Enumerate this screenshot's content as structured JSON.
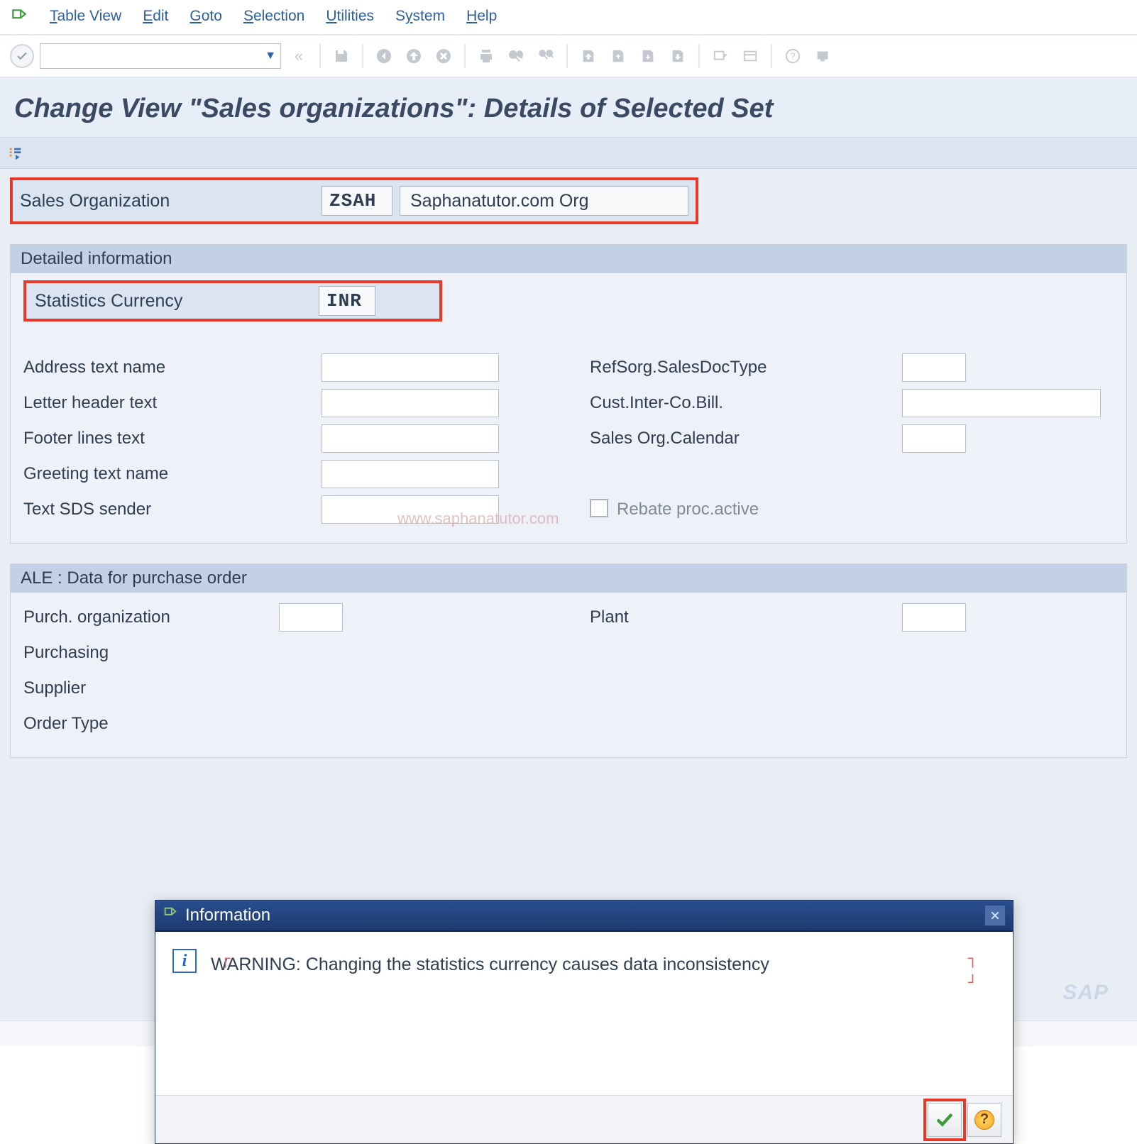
{
  "menu": {
    "items": [
      {
        "label_pre": "",
        "ul": "T",
        "label_post": "able View"
      },
      {
        "label_pre": "",
        "ul": "E",
        "label_post": "dit"
      },
      {
        "label_pre": "",
        "ul": "G",
        "label_post": "oto"
      },
      {
        "label_pre": "",
        "ul": "S",
        "label_post": "election"
      },
      {
        "label_pre": "",
        "ul": "U",
        "label_post": "tilities"
      },
      {
        "label_pre": "S",
        "ul": "y",
        "label_post": "stem"
      },
      {
        "label_pre": "",
        "ul": "H",
        "label_post": "elp"
      }
    ]
  },
  "title": "Change View \"Sales organizations\": Details of Selected Set",
  "header": {
    "label": "Sales Organization",
    "code": "ZSAH",
    "desc": "Saphanatutor.com Org"
  },
  "group1": {
    "title": "Detailed information",
    "stat_label": "Statistics Currency",
    "stat_value": "INR",
    "left": [
      "Address text name",
      "Letter header text",
      "Footer lines text",
      "Greeting text name",
      "Text SDS sender"
    ],
    "right": [
      "RefSorg.SalesDocType",
      "Cust.Inter-Co.Bill.",
      "Sales Org.Calendar"
    ],
    "checkbox_label": "Rebate proc.active"
  },
  "group2": {
    "title": "ALE : Data for purchase order",
    "left": [
      "Purch. organization",
      "Purchasing",
      "Supplier",
      "Order Type"
    ],
    "right": [
      "Plant"
    ]
  },
  "watermark": "www.saphanatutor.com",
  "popup": {
    "title": "Information",
    "message": "WARNING: Changing the statistics currency causes data inconsistency"
  }
}
